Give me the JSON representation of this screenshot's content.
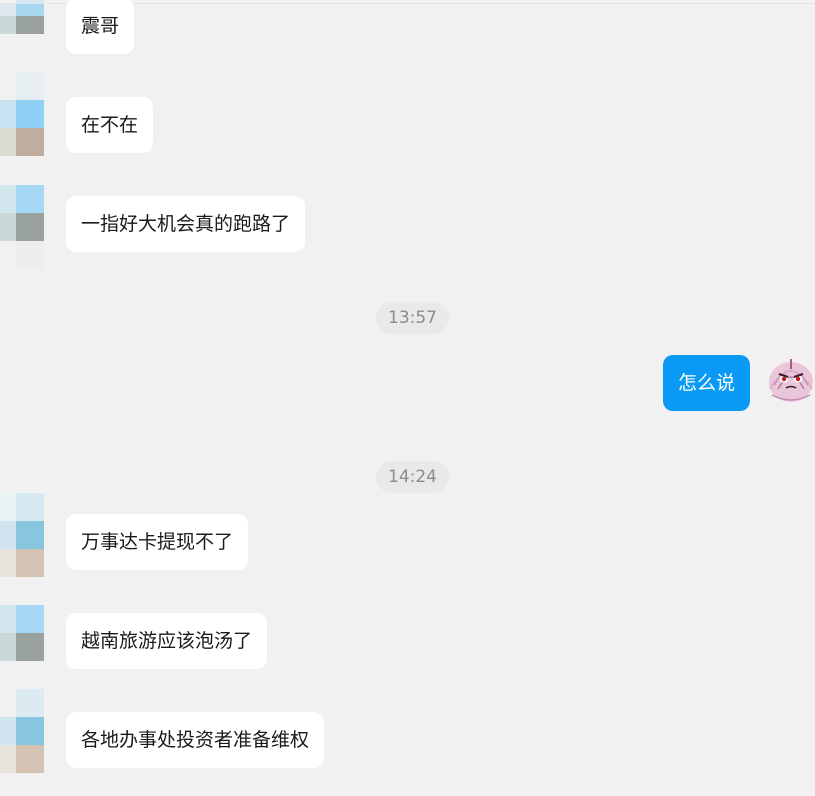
{
  "conversation": {
    "messages": [
      {
        "text": "震哥"
      },
      {
        "text": "在不在"
      },
      {
        "text": "一指好大机会真的跑路了"
      },
      {
        "time": "13:57"
      },
      {
        "text": "怎么说"
      },
      {
        "time": "14:24"
      },
      {
        "text": "万事达卡提现不了"
      },
      {
        "text": "越南旅游应该泡汤了"
      },
      {
        "text": "各地办事处投资者准备维权"
      }
    ]
  },
  "colors": {
    "background": "#f1f1f1",
    "incoming_bubble": "#ffffff",
    "outgoing_bubble": "#0a9af5",
    "timestamp_text": "#8c8c8c"
  },
  "icons": {
    "self_avatar": "onion-avatar-icon",
    "contact_avatar": "pixelated-avatar-icon"
  }
}
